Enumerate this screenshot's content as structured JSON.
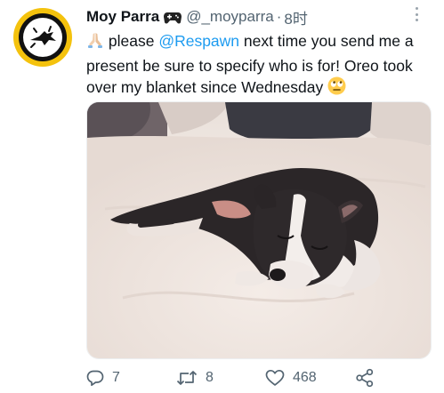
{
  "tweet": {
    "display_name": "Moy Parra",
    "name_badge_icon": "gamepad-icon",
    "handle": "@_moyparra",
    "separator": "·",
    "time": "8时",
    "text_prefix_emoji": "🙏🏻",
    "text_before_mention": "please ",
    "mention": "@Respawn",
    "text_after_mention": " next time you send me a present be sure to specify who is for! Oreo took over my blanket since Wednesday ",
    "text_suffix_emoji": "🙄",
    "media_alt": "Boston terrier sleeping on a white blanket"
  },
  "actions": {
    "reply_count": "7",
    "retweet_count": "8",
    "like_count": "468"
  },
  "colors": {
    "accent": "#1d9bf0",
    "secondary_text": "#536471",
    "avatar_ring": "#f4c20d"
  }
}
